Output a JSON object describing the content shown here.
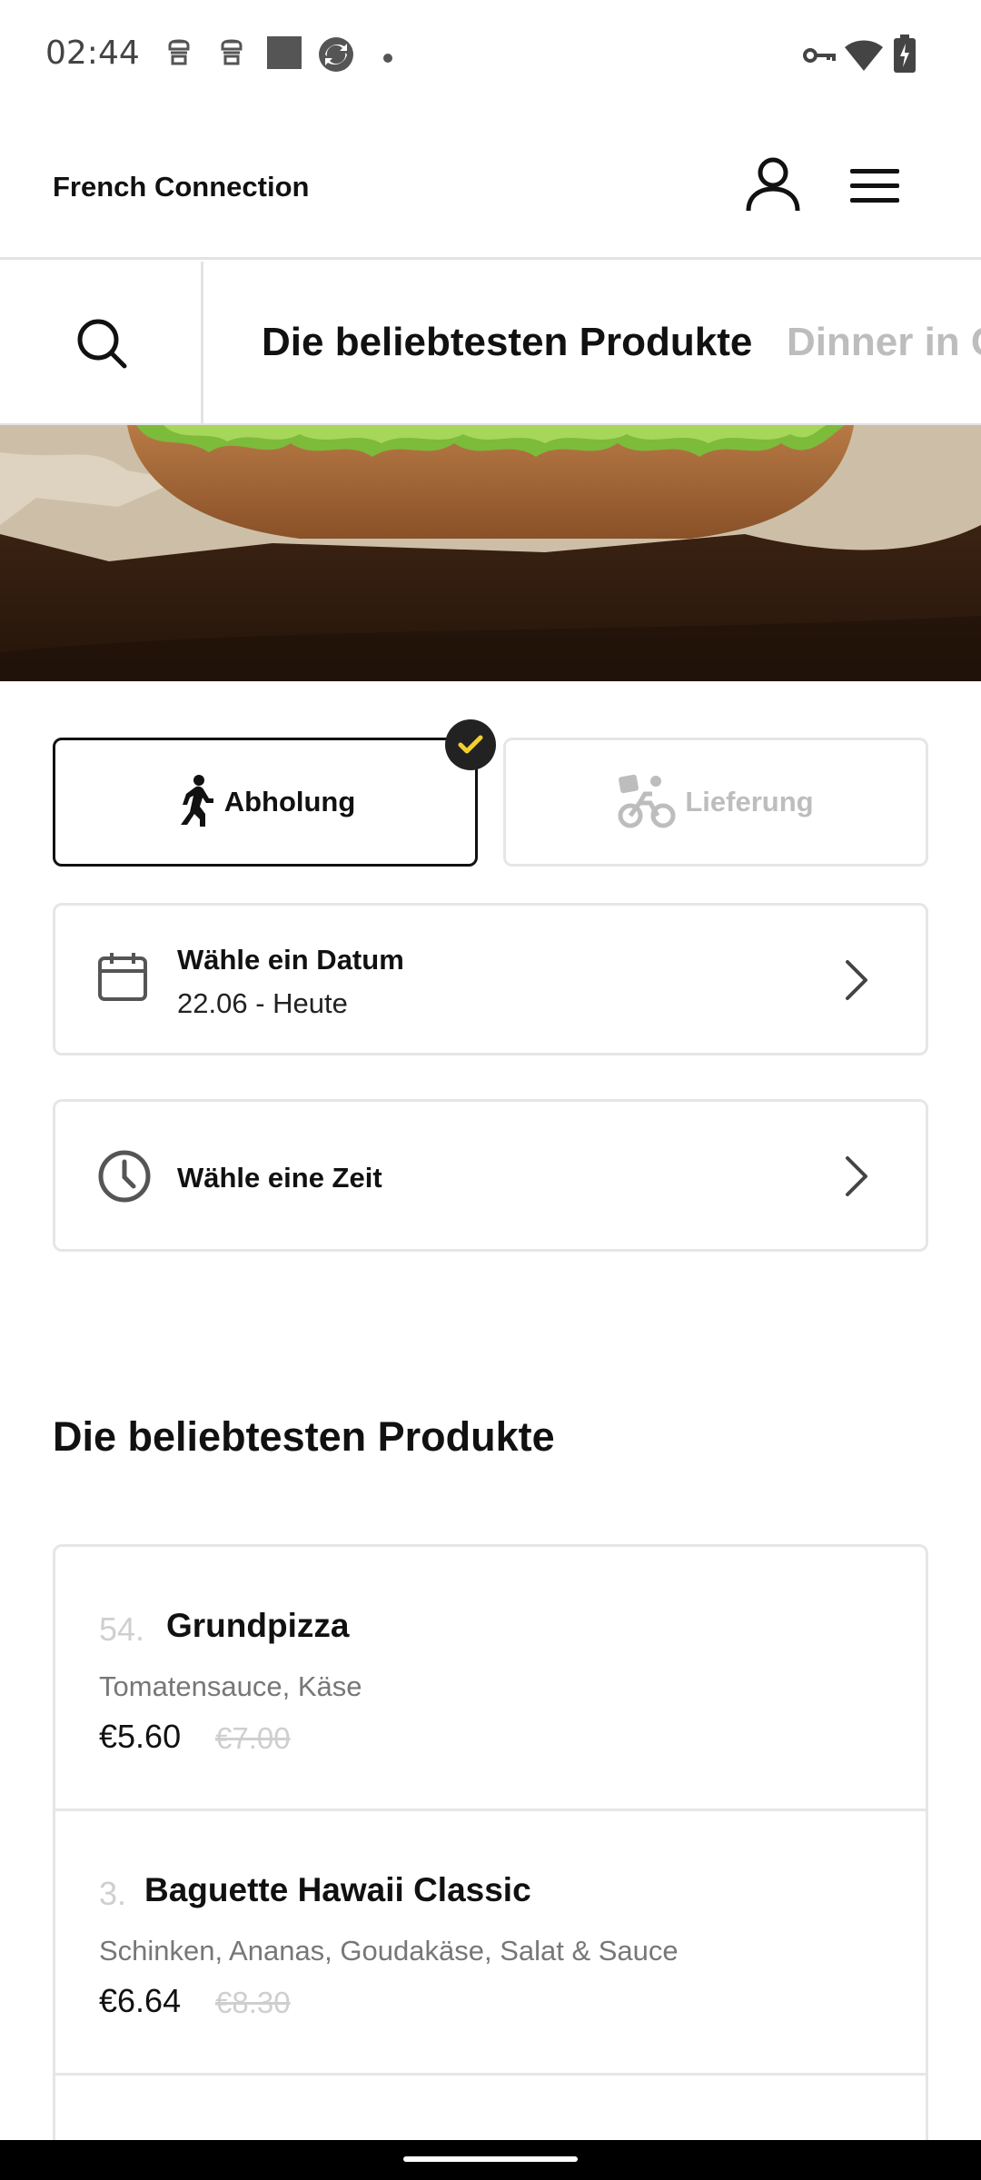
{
  "status_bar": {
    "time": "02:44",
    "icons": [
      "notification-icon",
      "notification-icon",
      "image-icon",
      "sync-icon",
      "dot-icon",
      "vpn-key-icon",
      "wifi-icon",
      "battery-charging-icon"
    ]
  },
  "header": {
    "brand": "French Connection",
    "icons": [
      "account-icon",
      "menu-icon"
    ]
  },
  "category_tabs": {
    "active": "Die beliebtesten Produkte",
    "next": "Dinner in C"
  },
  "order_mode": {
    "pickup_label": "Abholung",
    "delivery_label": "Lieferung",
    "selected": "pickup"
  },
  "date_selector": {
    "title": "Wähle ein Datum",
    "value": "22.06 - Heute"
  },
  "time_selector": {
    "title": "Wähle eine Zeit"
  },
  "section": {
    "title": "Die beliebtesten Produkte"
  },
  "products": [
    {
      "number": "54.",
      "name": "Grundpizza",
      "description": "Tomatensauce, Käse",
      "price": "€5.60",
      "old_price": "€7.00"
    },
    {
      "number": "3.",
      "name": "Baguette Hawaii Classic",
      "description": "Schinken, Ananas, Goudakäse, Salat & Sauce",
      "price": "€6.64",
      "old_price": "€8.30"
    }
  ],
  "colors": {
    "accent_check": "#f2d02e",
    "inactive_text": "#bdbdbd",
    "border": "#e6e6e6"
  }
}
